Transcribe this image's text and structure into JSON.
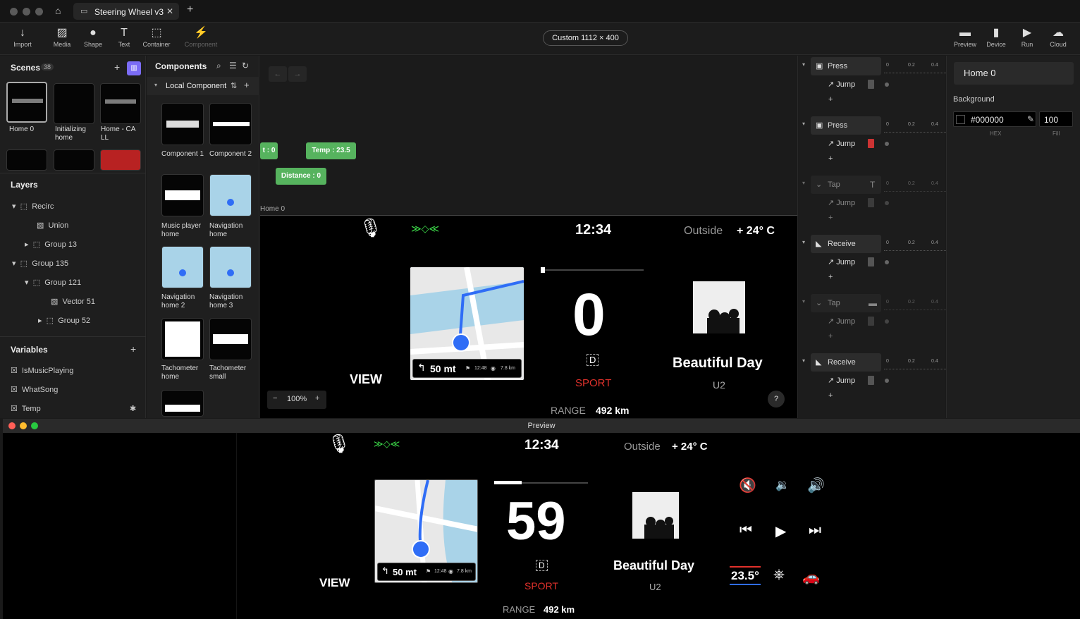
{
  "window": {
    "tab_title": "Steering Wheel v3"
  },
  "toolbar": {
    "items": [
      "Import",
      "Media",
      "Shape",
      "Text",
      "Container",
      "Component",
      "Preview",
      "Device",
      "Run",
      "Cloud"
    ],
    "canvas_size": "Custom  1112 × 400"
  },
  "scenes": {
    "title": "Scenes",
    "count": "38",
    "items": [
      "Home 0",
      "Initializing home",
      "Home - CA LL"
    ]
  },
  "layers": {
    "title": "Layers",
    "items": [
      "Recirc",
      "Union",
      "Group 13",
      "Group 135",
      "Group 121",
      "Vector 51",
      "Group 52"
    ]
  },
  "variables": {
    "title": "Variables",
    "items": [
      "IsMusicPlaying",
      "WhatSong",
      "Temp"
    ]
  },
  "components": {
    "title": "Components",
    "section": "Local Component",
    "items": [
      "Component 1",
      "Component 2",
      "Music player home",
      "Navigation home",
      "Navigation home 2",
      "Navigation home 3",
      "Tachometer home",
      "Tachometer small"
    ]
  },
  "canvas": {
    "chips": [
      "t : 0",
      "Temp : 23.5",
      "Distance : 0"
    ],
    "frame_label": "Home 0",
    "zoom": "100%",
    "help": "?"
  },
  "dashboard": {
    "time": "12:34",
    "outside_label": "Outside",
    "outside_temp": "+ 24° C",
    "view": "VIEW",
    "gear": "D",
    "mode": "SPORT",
    "range_label": "RANGE",
    "range_value": "492 km",
    "song": "Beautiful Day",
    "artist": "U2",
    "nav_distance": "50 mt",
    "nav_time": "12:48",
    "nav_km": "7.8 km",
    "speed": "0"
  },
  "preview": {
    "title": "Preview",
    "speed": "59",
    "climate_temp": "23.5°"
  },
  "interactions": {
    "triggers": [
      "Press",
      "Press",
      "Tap",
      "Receive",
      "Tap",
      "Receive"
    ],
    "action": "Jump",
    "ticks": [
      "0",
      "0.2",
      "0.4"
    ]
  },
  "properties": {
    "name": "Home 0",
    "background_label": "Background",
    "hex": "#000000",
    "fill": "100",
    "hex_label": "HEX",
    "fill_label": "Fill"
  },
  "colors": {
    "accent": "#7b6cf6",
    "chip": "#56b35e",
    "sport": "#e0312b",
    "nav_blue": "#2f6df6"
  }
}
